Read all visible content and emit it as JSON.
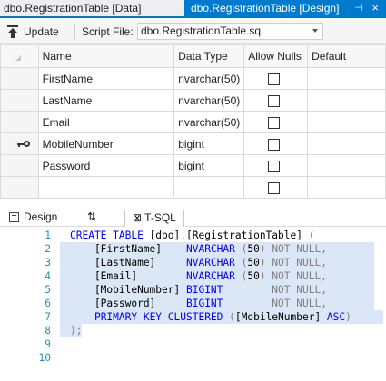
{
  "tabs": {
    "inactive_label": "dbo.RegistrationTable [Data]",
    "active_label": "dbo.RegistrationTable [Design]",
    "pin_glyph": "⊣",
    "close_glyph": "×"
  },
  "toolbar": {
    "update_label": "Update",
    "script_file_label": "Script File:",
    "script_file_value": "dbo.RegistrationTable.sql"
  },
  "grid": {
    "headers": {
      "name": "Name",
      "data_type": "Data Type",
      "allow_nulls": "Allow Nulls",
      "default": "Default"
    },
    "rows": [
      {
        "name": "FirstName",
        "data_type": "nvarchar(50)",
        "primary_key": false
      },
      {
        "name": "LastName",
        "data_type": "nvarchar(50)",
        "primary_key": false
      },
      {
        "name": "Email",
        "data_type": "nvarchar(50)",
        "primary_key": false
      },
      {
        "name": "MobileNumber",
        "data_type": "bigint",
        "primary_key": true
      },
      {
        "name": "Password",
        "data_type": "bigint",
        "primary_key": false
      },
      {
        "name": "",
        "data_type": "",
        "primary_key": false
      }
    ]
  },
  "pane_tabs": {
    "design_label": "Design",
    "swap_glyph": "⇅",
    "tsql_label": "⊠ T-SQL"
  },
  "editor": {
    "line_numbers": [
      "1",
      "2",
      "3",
      "4",
      "5",
      "6",
      "7",
      "8",
      "9",
      "10"
    ],
    "lines": [
      [
        {
          "t": "CREATE TABLE ",
          "c": "kw"
        },
        {
          "t": "[dbo]",
          "c": "id"
        },
        {
          "t": ".",
          "c": "op"
        },
        {
          "t": "[RegistrationTable]",
          "c": "id"
        },
        {
          "t": " (",
          "c": "op"
        }
      ],
      [
        {
          "t": "    [FirstName]    ",
          "c": "id"
        },
        {
          "t": "NVARCHAR ",
          "c": "kw"
        },
        {
          "t": "(",
          "c": "op"
        },
        {
          "t": "50",
          "c": "num"
        },
        {
          "t": ") ",
          "c": "op"
        },
        {
          "t": "NOT NULL",
          "c": "op"
        },
        {
          "t": ",",
          "c": "op"
        }
      ],
      [
        {
          "t": "    [LastName]     ",
          "c": "id"
        },
        {
          "t": "NVARCHAR ",
          "c": "kw"
        },
        {
          "t": "(",
          "c": "op"
        },
        {
          "t": "50",
          "c": "num"
        },
        {
          "t": ") ",
          "c": "op"
        },
        {
          "t": "NOT NULL",
          "c": "op"
        },
        {
          "t": ",",
          "c": "op"
        }
      ],
      [
        {
          "t": "    [Email]        ",
          "c": "id"
        },
        {
          "t": "NVARCHAR ",
          "c": "kw"
        },
        {
          "t": "(",
          "c": "op"
        },
        {
          "t": "50",
          "c": "num"
        },
        {
          "t": ") ",
          "c": "op"
        },
        {
          "t": "NOT NULL",
          "c": "op"
        },
        {
          "t": ",",
          "c": "op"
        }
      ],
      [
        {
          "t": "    [MobileNumber] ",
          "c": "id"
        },
        {
          "t": "BIGINT",
          "c": "kw"
        },
        {
          "t": "        NOT NULL",
          "c": "op"
        },
        {
          "t": ",",
          "c": "op"
        }
      ],
      [
        {
          "t": "    [Password]     ",
          "c": "id"
        },
        {
          "t": "BIGINT",
          "c": "kw"
        },
        {
          "t": "        NOT NULL",
          "c": "op"
        },
        {
          "t": ",",
          "c": "op"
        }
      ],
      [
        {
          "t": "    ",
          "c": "id"
        },
        {
          "t": "PRIMARY KEY CLUSTERED ",
          "c": "kw"
        },
        {
          "t": "(",
          "c": "op"
        },
        {
          "t": "[MobileNumber]",
          "c": "id"
        },
        {
          "t": " ASC",
          "c": "kw"
        },
        {
          "t": ")",
          "c": "op"
        }
      ],
      [
        {
          "t": ");",
          "c": "op"
        }
      ],
      [],
      []
    ]
  }
}
